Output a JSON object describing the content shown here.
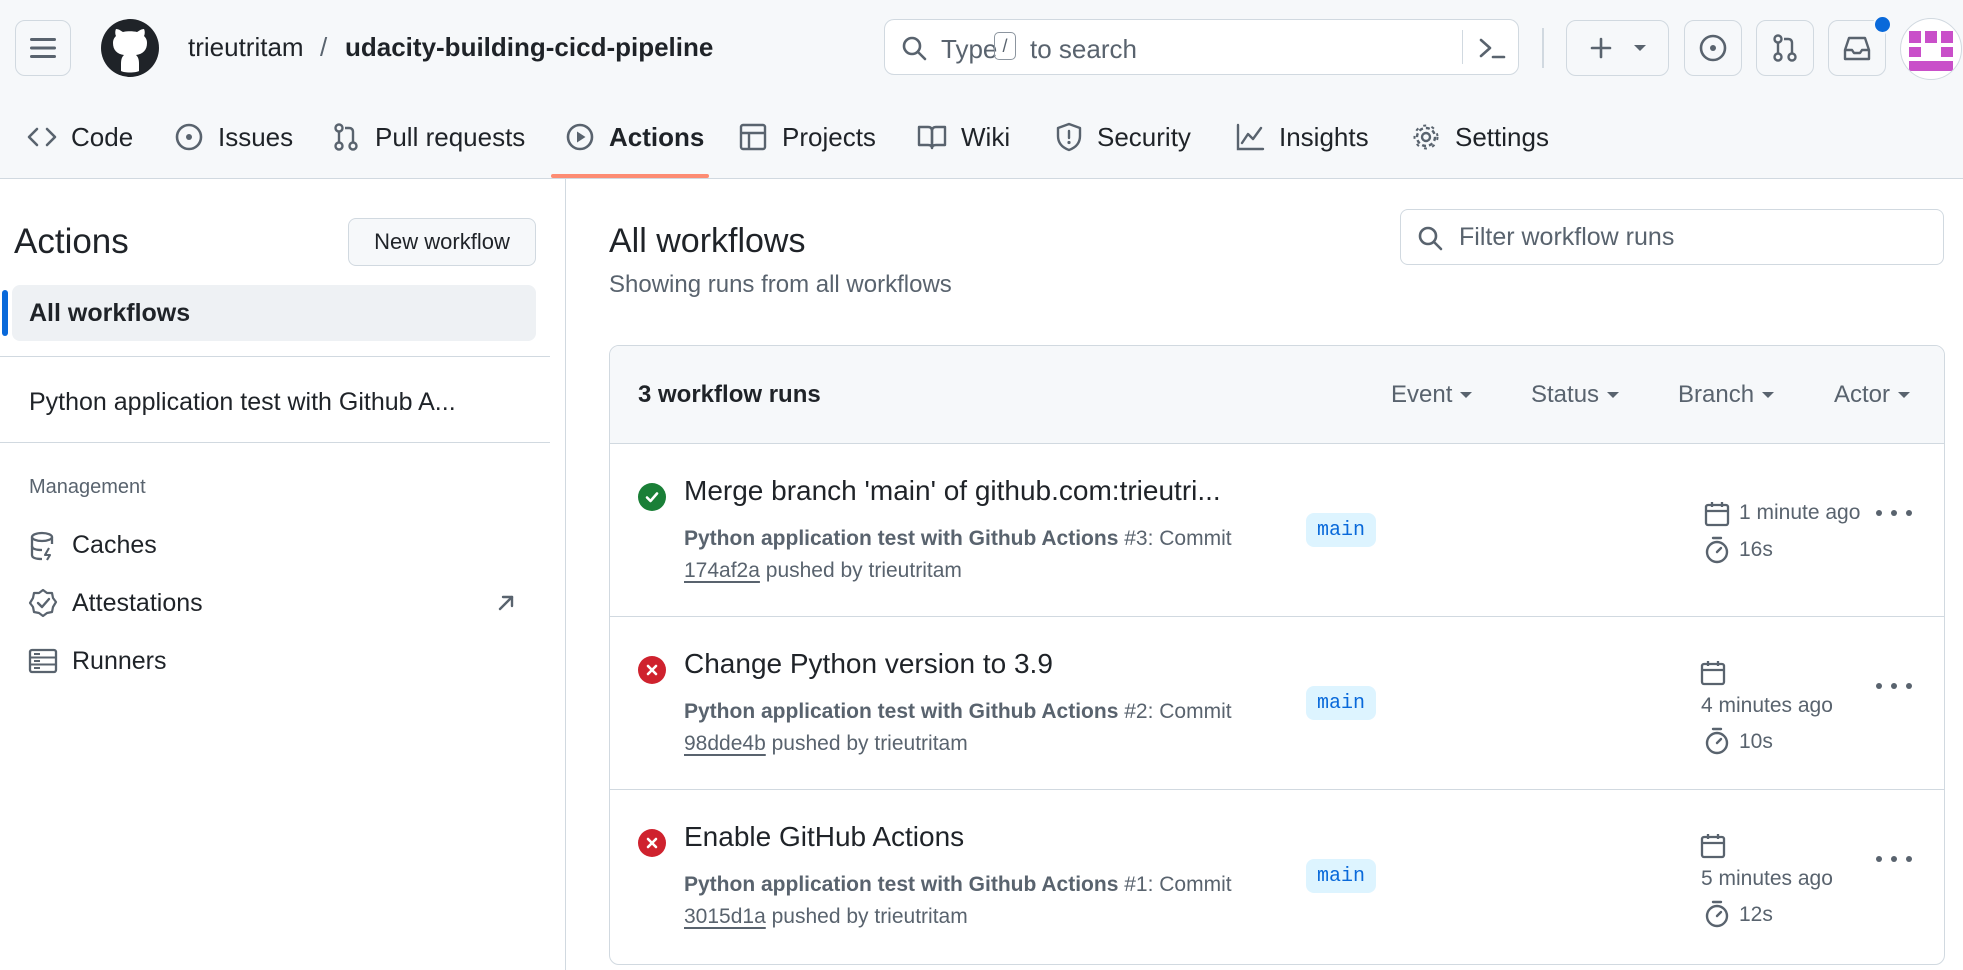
{
  "header": {
    "owner": "trieutritam",
    "separator": "/",
    "repo": "udacity-building-cicd-pipeline",
    "search": {
      "prefix": "Type",
      "key": "/",
      "suffix": "to search"
    }
  },
  "tabs": [
    {
      "label": "Code",
      "icon": "code-icon"
    },
    {
      "label": "Issues",
      "icon": "issue-icon"
    },
    {
      "label": "Pull requests",
      "icon": "pull-request-icon"
    },
    {
      "label": "Actions",
      "icon": "play-icon",
      "active": true
    },
    {
      "label": "Projects",
      "icon": "table-icon"
    },
    {
      "label": "Wiki",
      "icon": "book-icon"
    },
    {
      "label": "Security",
      "icon": "shield-icon"
    },
    {
      "label": "Insights",
      "icon": "graph-icon"
    },
    {
      "label": "Settings",
      "icon": "gear-icon"
    }
  ],
  "sidebar": {
    "title": "Actions",
    "new_workflow": "New workflow",
    "all_workflows": "All workflows",
    "workflow_item": "Python application test with Github A...",
    "management_label": "Management",
    "management": [
      {
        "label": "Caches",
        "icon": "database-icon"
      },
      {
        "label": "Attestations",
        "icon": "verified-icon"
      },
      {
        "label": "Runners",
        "icon": "server-icon"
      }
    ]
  },
  "main": {
    "title": "All workflows",
    "subtitle": "Showing runs from all workflows",
    "filter_placeholder": "Filter workflow runs",
    "runs_count": "3 workflow runs",
    "filters": [
      "Event",
      "Status",
      "Branch",
      "Actor"
    ],
    "runs": [
      {
        "status": "success",
        "title": "Merge branch 'main' of github.com:trieutri...",
        "workflow": "Python application test with Github Actions",
        "run_label": "#3: Commit",
        "sha": "174af2a",
        "pushed_by": "pushed by trieutritam",
        "branch": "main",
        "time": "1 minute ago",
        "duration": "16s"
      },
      {
        "status": "failure",
        "title": "Change Python version to 3.9",
        "workflow": "Python application test with Github Actions",
        "run_label": "#2: Commit",
        "sha": "98dde4b",
        "pushed_by": "pushed by trieutritam",
        "branch": "main",
        "time": "4 minutes ago",
        "duration": "10s"
      },
      {
        "status": "failure",
        "title": "Enable GitHub Actions",
        "workflow": "Python application test with Github Actions",
        "run_label": "#1: Commit",
        "sha": "3015d1a",
        "pushed_by": "pushed by trieutritam",
        "branch": "main",
        "time": "5 minutes ago",
        "duration": "12s"
      }
    ]
  },
  "colors": {
    "success": "#1a7f37",
    "failure": "#cf222e",
    "accent": "#0969da",
    "tab_underline": "#fd8c73"
  }
}
